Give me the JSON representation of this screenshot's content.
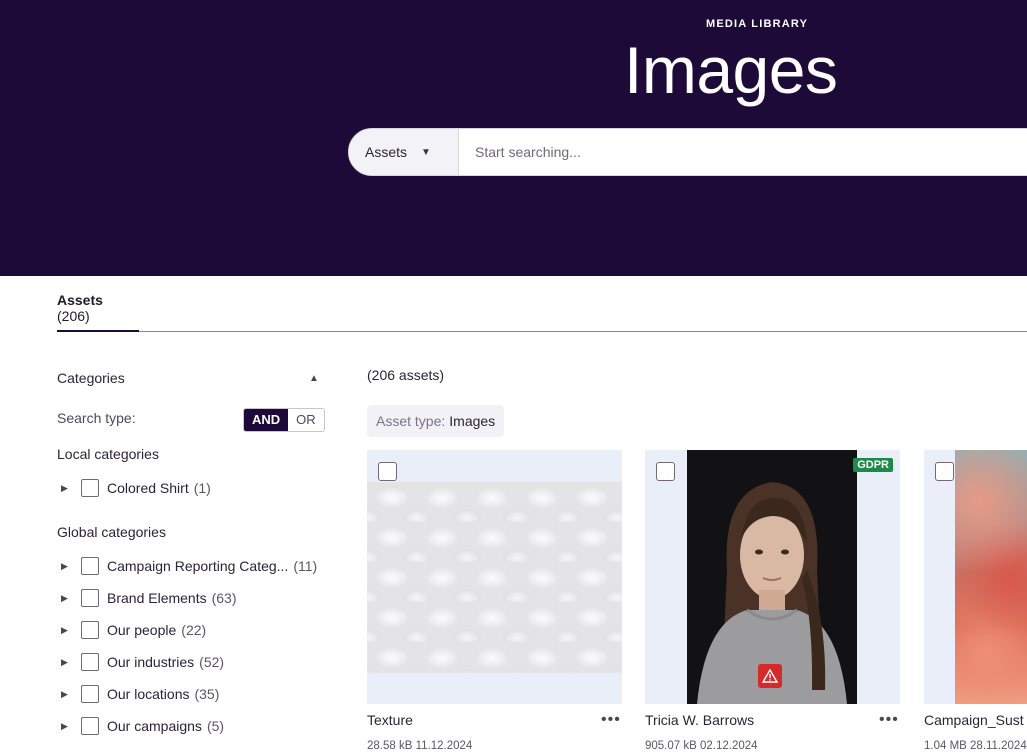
{
  "hero": {
    "kicker": "MEDIA LIBRARY",
    "title": "Images"
  },
  "search": {
    "scope": "Assets",
    "placeholder": "Start searching..."
  },
  "tabs": [
    {
      "label": "Assets",
      "count": "(206)"
    }
  ],
  "filters": {
    "heading": "Categories",
    "search_type_label": "Search type:",
    "toggle": [
      "AND",
      "OR"
    ],
    "local_label": "Local categories",
    "local": [
      {
        "label": "Colored Shirt",
        "count": "(1)"
      }
    ],
    "global_label": "Global categories",
    "global": [
      {
        "label": "Campaign Reporting Categ...",
        "count": "(11)"
      },
      {
        "label": "Brand Elements",
        "count": "(63)"
      },
      {
        "label": "Our people",
        "count": "(22)"
      },
      {
        "label": "Our industries",
        "count": "(52)"
      },
      {
        "label": "Our locations",
        "count": "(35)"
      },
      {
        "label": "Our campaigns",
        "count": "(5)"
      }
    ]
  },
  "results": {
    "count": "(206 assets)",
    "chip_key": "Asset type:",
    "chip_value": "Images",
    "cards": [
      {
        "name": "Texture",
        "meta": "28.58 kB 11.12.2024"
      },
      {
        "name": "Tricia W. Barrows",
        "meta": "905.07 kB 02.12.2024",
        "badge": "GDPR"
      },
      {
        "name": "Campaign_Sust",
        "meta": "1.04 MB 28.11.2024"
      }
    ]
  },
  "colors": {
    "hero_bg": "#1d0a39",
    "gdpr_badge": "#1e8a4a",
    "warning": "#d42a2a"
  }
}
